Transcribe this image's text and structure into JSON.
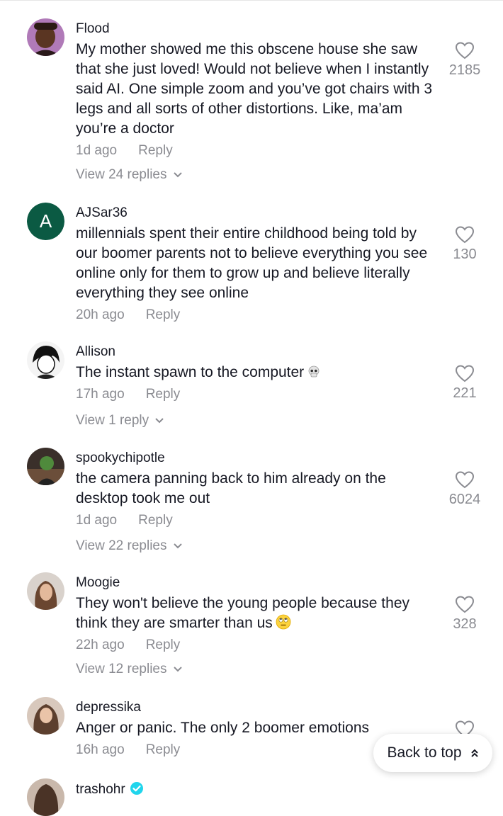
{
  "comments": [
    {
      "username": "Flood",
      "avatar": "photo",
      "text": "My mother showed me this obscene house she saw that she just loved! Would not believe when I instantly said AI. One simple zoom and you’ve got chairs with 3 legs and all sorts of other distortions. Like, ma’am you’re a doctor",
      "time": "1d ago",
      "reply_label": "Reply",
      "likes": "2185",
      "view_replies": "View 24 replies"
    },
    {
      "username": "AJSar36",
      "avatar_letter": "A",
      "text": "millennials spent their entire childhood being told by our boomer parents not to believe everything you see online only for them to grow up and believe literally everything they see online",
      "time": "20h ago",
      "reply_label": "Reply",
      "likes": "130"
    },
    {
      "username": "Allison",
      "text": "The instant spawn to the computer",
      "emoji": "skull-emoji",
      "time": "17h ago",
      "reply_label": "Reply",
      "likes": "221",
      "view_replies": "View 1 reply"
    },
    {
      "username": "spookychipotle",
      "text": "the camera panning back to him already on the desktop took me out",
      "time": "1d ago",
      "reply_label": "Reply",
      "likes": "6024",
      "view_replies": "View 22 replies"
    },
    {
      "username": "Moogie",
      "text": "They won't believe the young people because they think they are smarter than us",
      "emoji": "eye-roll-emoji",
      "time": "22h ago",
      "reply_label": "Reply",
      "likes": "328",
      "view_replies": "View 12 replies"
    },
    {
      "username": "depressika",
      "text": "Anger or panic. The only 2 boomer emotions",
      "time": "16h ago",
      "reply_label": "Reply"
    },
    {
      "username": "trashohr",
      "verified": true
    }
  ],
  "back_to_top": "Back to top",
  "colors": {
    "muted": "#8a8b91",
    "text": "#161823",
    "avatar_green": "#0b5a43",
    "verified_blue": "#20d5ec"
  }
}
